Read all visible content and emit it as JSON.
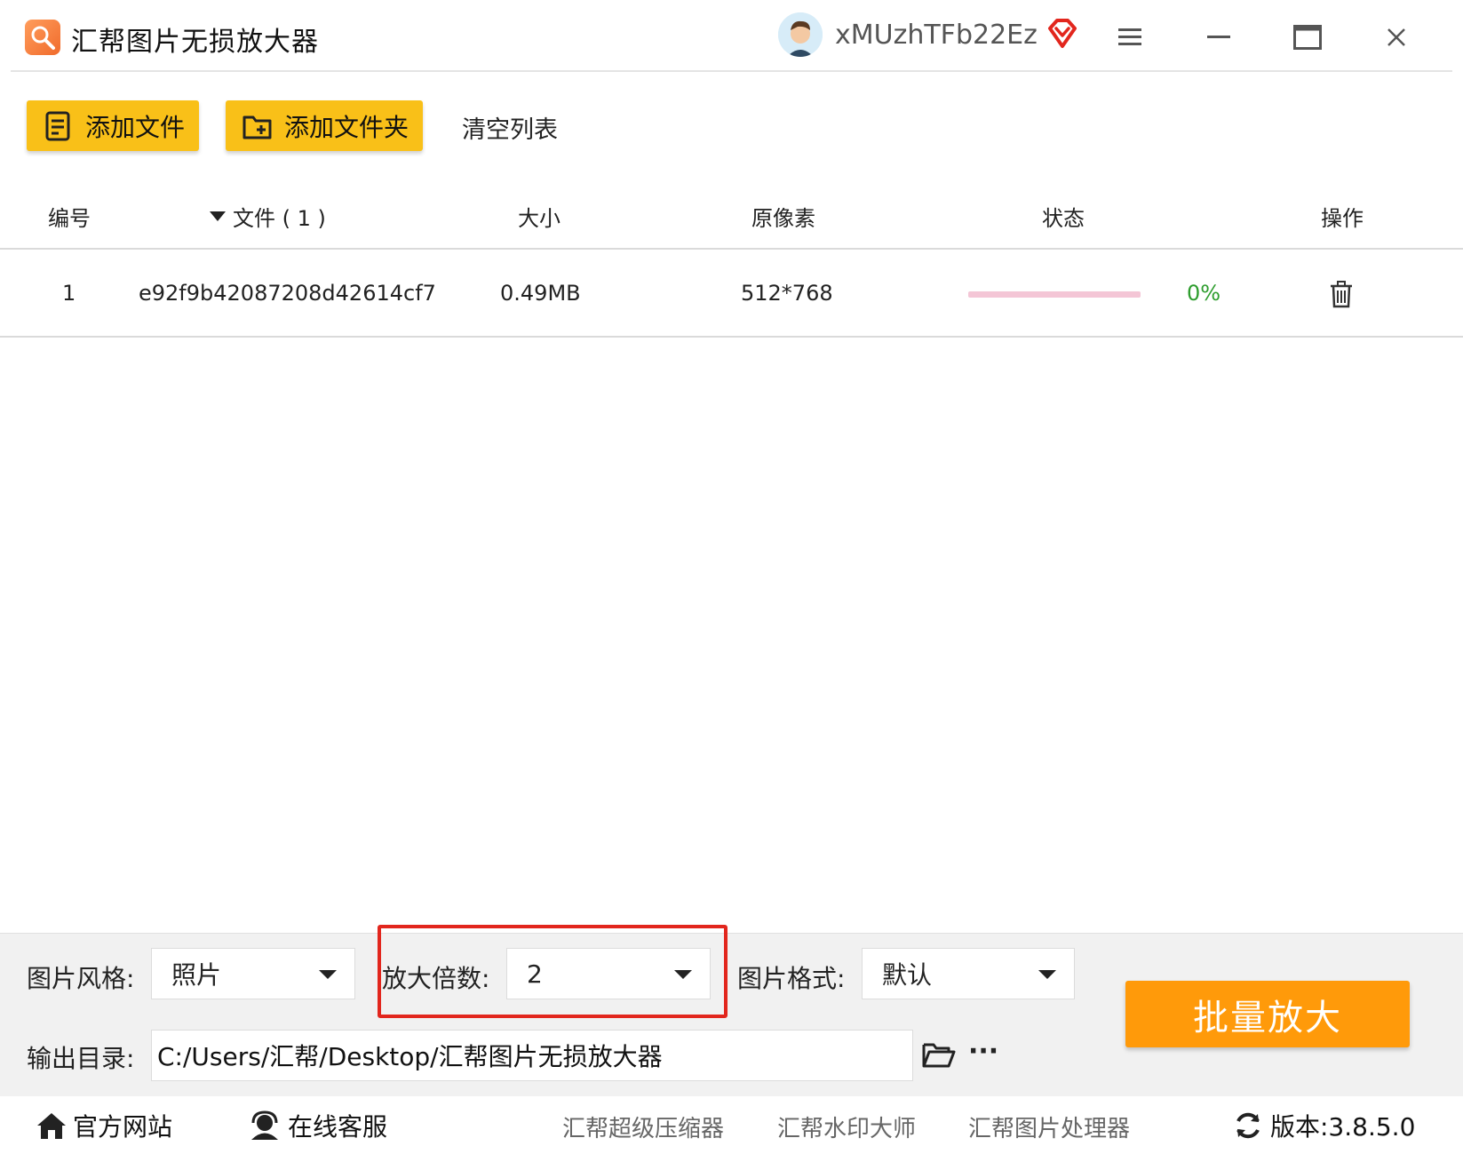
{
  "window": {
    "title": "汇帮图片无损放大器",
    "username": "xMUzhTFb22Ez"
  },
  "toolbar": {
    "add_file": "添加文件",
    "add_folder": "添加文件夹",
    "clear_list": "清空列表"
  },
  "table": {
    "headers": {
      "index": "编号",
      "file": "文件 ( 1 )",
      "size": "大小",
      "pixels": "原像素",
      "status": "状态",
      "action": "操作"
    },
    "rows": [
      {
        "index": "1",
        "file": "e92f9b42087208d42614cf7",
        "size": "0.49MB",
        "pixels": "512*768",
        "progress_percent": 0,
        "status_text": "0%"
      }
    ]
  },
  "settings": {
    "style_label": "图片风格:",
    "style_value": "照片",
    "scale_label": "放大倍数:",
    "scale_value": "2",
    "format_label": "图片格式:",
    "format_value": "默认",
    "output_label": "输出目录:",
    "output_path": "C:/Users/汇帮/Desktop/汇帮图片无损放大器",
    "more": "···",
    "batch_button": "批量放大"
  },
  "footer": {
    "website": "官方网站",
    "support": "在线客服",
    "links": [
      "汇帮超级压缩器",
      "汇帮水印大师",
      "汇帮图片处理器"
    ],
    "version": "版本:3.8.5.0"
  },
  "colors": {
    "accent_yellow": "#f9c018",
    "batch_orange": "#ff9a0a",
    "highlight_red": "#e2261d",
    "progress_pink": "#f4c6d6",
    "percent_green": "#2e9d2e"
  }
}
